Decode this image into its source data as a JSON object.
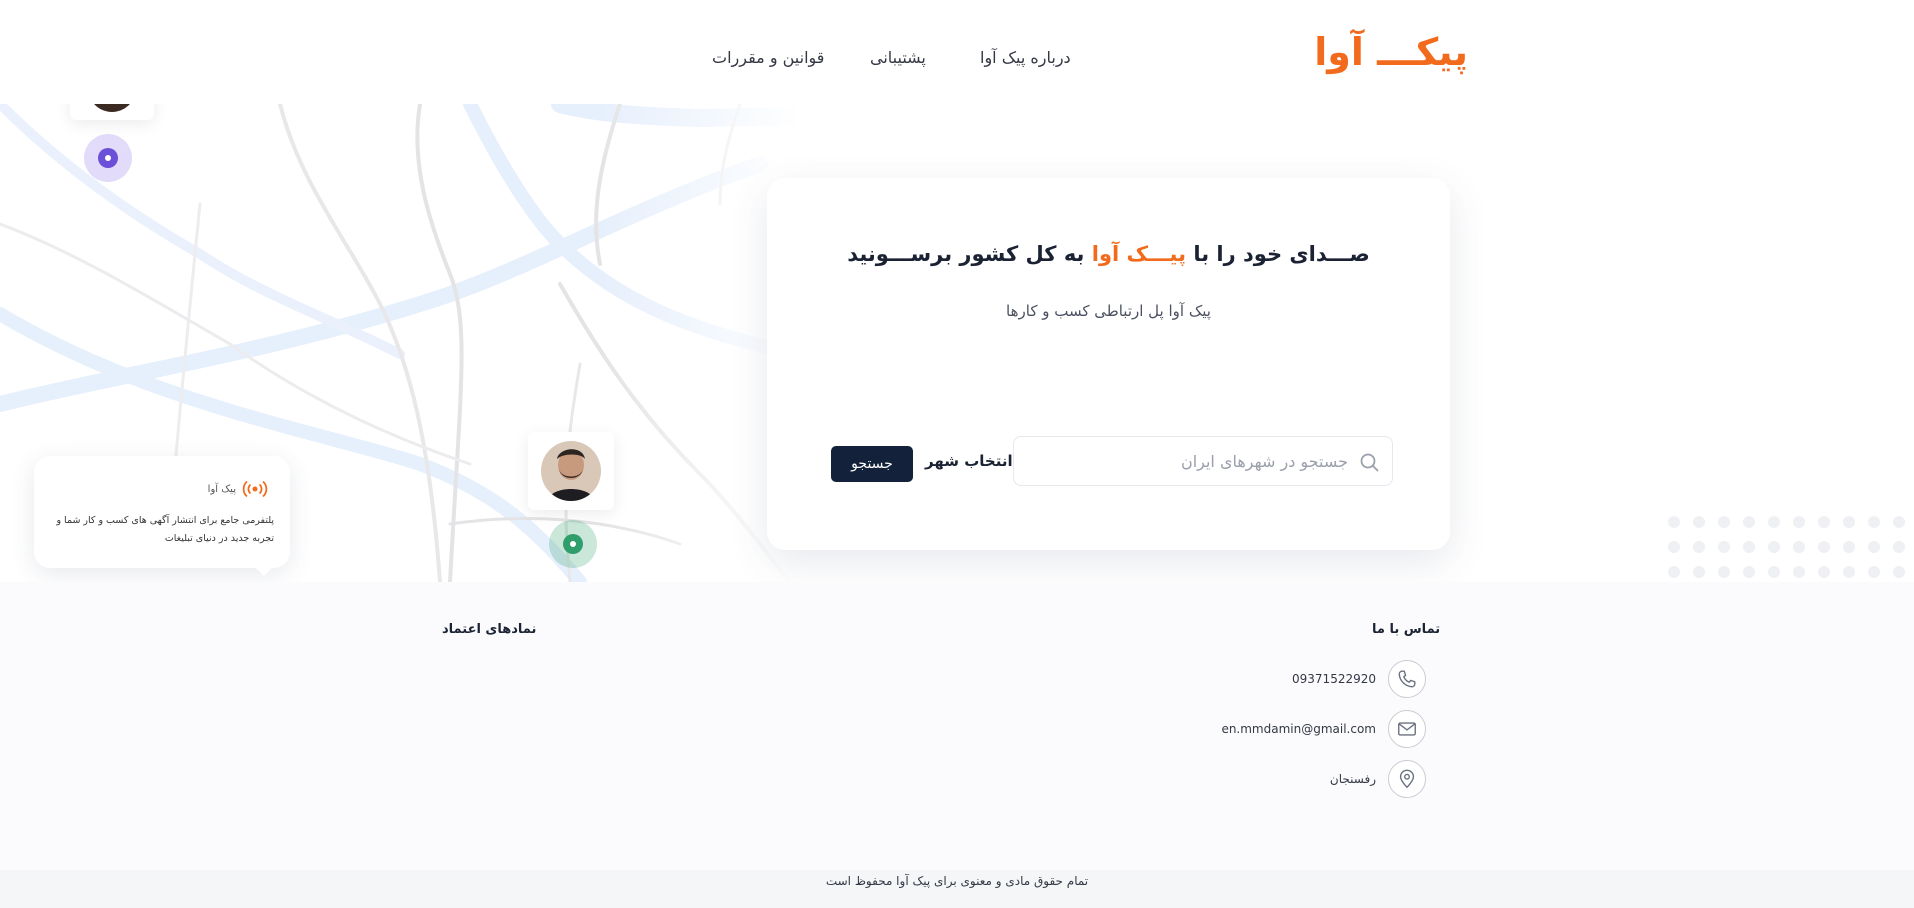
{
  "header": {
    "logo": "پیکـــ آوا",
    "nav": [
      "درباره پیک آوا",
      "پشتیبانی",
      "قوانین و مقررات"
    ]
  },
  "hero": {
    "headline_part1": "صـــدای خود را با ",
    "headline_accent": "پیـــک آوا",
    "headline_part2": " به کل کشور برســـونید",
    "subline": "پیک آوا پل ارتباطی کسب و کارها",
    "search_placeholder": "جستجو در شهرهای ایران",
    "city_select": "انتخاب شهر",
    "search_button": "جستجو",
    "info_card": {
      "brand": "پیک آوا",
      "description": "پلتفرمی  جامع برای انتشار آگهی های کسب و کار شما  و تجربه جدید در دنیای تبلیغات"
    }
  },
  "footer": {
    "contact_title": "تماس با ما",
    "trust_title": "نمادهای اعتماد",
    "phone": "09371522920",
    "email": "en.mmdamin@gmail.com",
    "address": "رفسنجان",
    "copyright": "تمام حقوق مادی و معنوی برای پیک آوا محفوظ است"
  },
  "colors": {
    "accent": "#f26b1d",
    "button": "#14213a",
    "pin_purple": "#6b4fd8",
    "pin_green": "#2f9e6a"
  },
  "icons": [
    "search-icon",
    "phone-icon",
    "mail-icon",
    "location-icon",
    "broadcast-icon"
  ]
}
